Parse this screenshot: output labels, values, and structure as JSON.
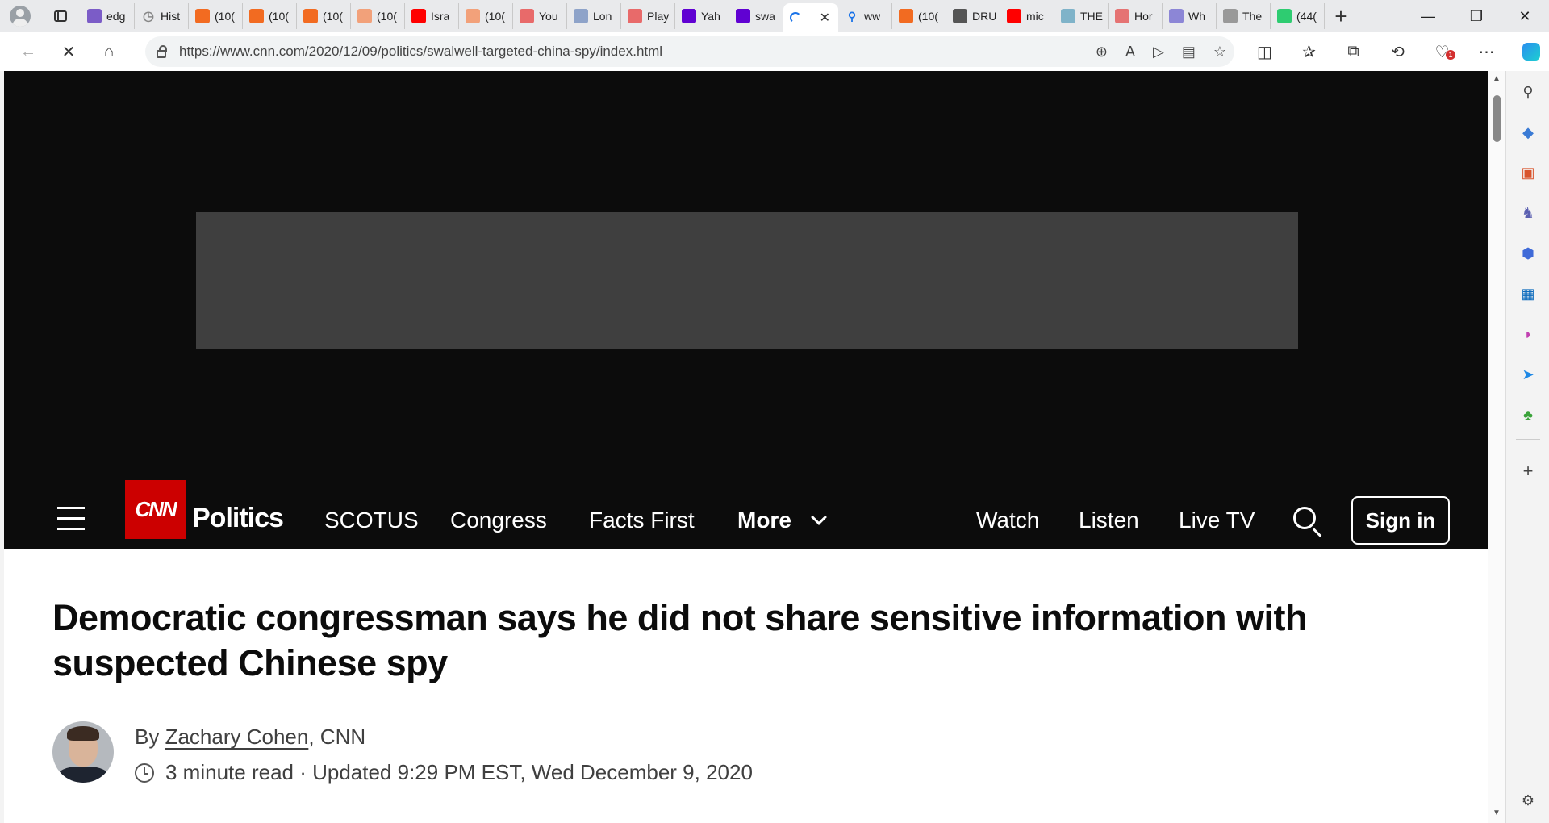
{
  "browser": {
    "tabs": [
      {
        "label": "edg",
        "icon": "yahoo-icon",
        "color": "#7b5cc7"
      },
      {
        "label": "Hist",
        "icon": "history-icon",
        "color": "#888888"
      },
      {
        "label": "(10(",
        "icon": "bookmark-icon",
        "color": "#f26b21"
      },
      {
        "label": "(10(",
        "icon": "bookmark-icon",
        "color": "#f26b21"
      },
      {
        "label": "(10(",
        "icon": "bookmark-icon",
        "color": "#f26b21"
      },
      {
        "label": "(10(",
        "icon": "bookmark-icon",
        "color": "#f2a17a"
      },
      {
        "label": "Isra",
        "icon": "youtube-icon",
        "color": "#ff0000"
      },
      {
        "label": "(10(",
        "icon": "bookmark-icon",
        "color": "#f2a17a"
      },
      {
        "label": "You",
        "icon": "youtube-icon",
        "color": "#e86a6a"
      },
      {
        "label": "Lon",
        "icon": "letter-l-icon",
        "color": "#8ea3c9"
      },
      {
        "label": "Play",
        "icon": "youtube-icon",
        "color": "#e86a6a"
      },
      {
        "label": "Yah",
        "icon": "yahoo-icon",
        "color": "#6001d2"
      },
      {
        "label": "swa",
        "icon": "yahoo-icon",
        "color": "#6001d2"
      },
      {
        "label": "",
        "icon": "loading-icon",
        "color": "#1a73e8",
        "active": true
      },
      {
        "label": "ww",
        "icon": "search-icon",
        "color": "#1a73e8"
      },
      {
        "label": "(10(",
        "icon": "bookmark-icon",
        "color": "#f26b21"
      },
      {
        "label": "DRU",
        "icon": "drudge-icon",
        "color": "#555555"
      },
      {
        "label": "mic",
        "icon": "youtube-icon",
        "color": "#ff0000"
      },
      {
        "label": "THE",
        "icon": "chart-icon",
        "color": "#7fb3c9"
      },
      {
        "label": "Hor",
        "icon": "mic-icon",
        "color": "#e57373"
      },
      {
        "label": "Wh",
        "icon": "shield-icon",
        "color": "#8c86d6"
      },
      {
        "label": "The",
        "icon": "dots-icon",
        "color": "#999999"
      },
      {
        "label": "(44(",
        "icon": "letter-g-icon",
        "color": "#2ecc71"
      }
    ],
    "active_tab_close": "✕",
    "new_tab": "+",
    "window_controls": {
      "minimize": "—",
      "maximize": "❐",
      "close": "✕"
    },
    "url": "https://www.cnn.com/2020/12/09/politics/swalwell-targeted-china-spy/index.html",
    "url_icons": [
      "zoom-icon",
      "read-aloud-icon",
      "video-icon",
      "immersive-reader-icon",
      "favorite-star-icon"
    ],
    "toolbar_icons": [
      "split-screen-icon",
      "favorites-icon",
      "collections-icon",
      "history-icon",
      "health-icon",
      "more-icon"
    ],
    "notification_count": "1"
  },
  "site": {
    "logo": "CNN",
    "section": "Politics",
    "nav_links": [
      "SCOTUS",
      "Congress",
      "Facts First",
      "More"
    ],
    "right_links": [
      "Watch",
      "Listen",
      "Live TV"
    ],
    "signin_label": "Sign in"
  },
  "article": {
    "headline": "Democratic congressman says he did not share sensitive information with suspected Chinese spy",
    "by_prefix": "By ",
    "author": "Zachary Cohen",
    "outlet": ", CNN",
    "read_time": "3 minute read",
    "separator": " · ",
    "updated": "Updated 9:29 PM EST, Wed December 9, 2020"
  }
}
